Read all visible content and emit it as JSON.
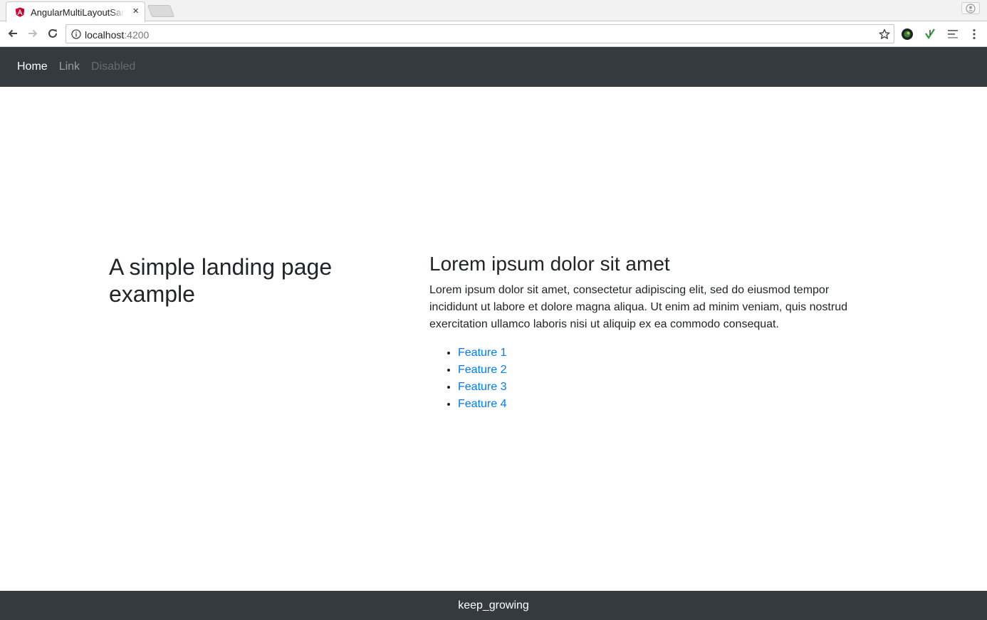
{
  "browser": {
    "tab": {
      "title": "AngularMultiLayoutSample",
      "favicon": "angular-icon"
    },
    "url": {
      "host": "localhost",
      "port": ":4200"
    },
    "colors": {
      "angular_red": "#dd0031"
    }
  },
  "navbar": {
    "items": [
      {
        "label": "Home",
        "state": "active"
      },
      {
        "label": "Link",
        "state": "default"
      },
      {
        "label": "Disabled",
        "state": "disabled"
      }
    ],
    "background": "#343a40"
  },
  "main": {
    "hero_title": "A simple landing page example",
    "heading": "Lorem ipsum dolor sit amet",
    "paragraph": "Lorem ipsum dolor sit amet, consectetur adipiscing elit, sed do eiusmod tempor incididunt ut labore et dolore magna aliqua. Ut enim ad minim veniam, quis nostrud exercitation ullamco laboris nisi ut aliquip ex ea commodo consequat.",
    "features": [
      "Feature 1",
      "Feature 2",
      "Feature 3",
      "Feature 4"
    ],
    "link_color": "#007bff"
  },
  "footer": {
    "text": "keep_growing"
  }
}
